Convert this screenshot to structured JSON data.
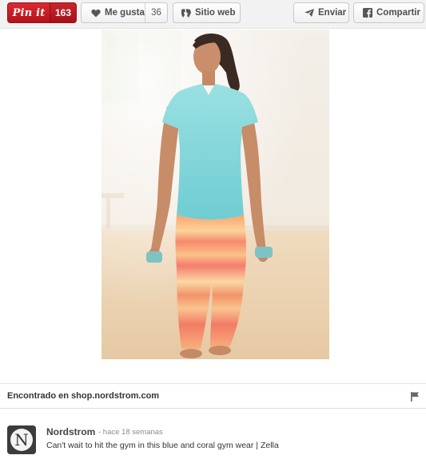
{
  "actions": {
    "pinit_label": "Pin it",
    "pinit_count": "163",
    "like_label": "Me gusta",
    "like_count": "36",
    "website_label": "Sitio web",
    "send_label": "Enviar",
    "facebook_label": "Compartir"
  },
  "source": {
    "label": "Encontrado en shop.nordstrom.com"
  },
  "pinner": {
    "name": "Nordstrom",
    "time": "- hace 18 semanas",
    "description": "Can't wait to hit the gym in this blue and coral gym wear | Zella",
    "avatar_letter": "N"
  },
  "colors": {
    "pinit_red": "#c8232c",
    "shirt_blue": "#7fd3d8",
    "legging_coral": "#f4956b"
  },
  "icons": {
    "like": "heart-icon",
    "website": "globe-icon",
    "send": "send-icon",
    "facebook": "facebook-icon",
    "flag": "flag-icon"
  }
}
